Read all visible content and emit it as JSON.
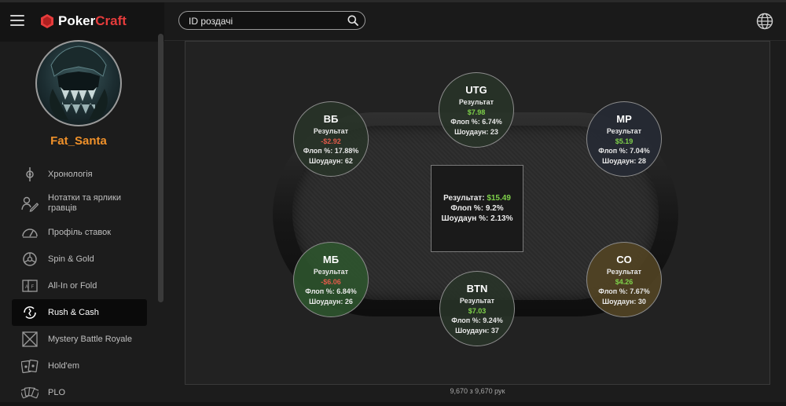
{
  "app": {
    "logo_part1": "Poker",
    "logo_part2": "Craft"
  },
  "user": {
    "name": "Fat_Santa"
  },
  "search": {
    "placeholder": "ID роздачі"
  },
  "nav": [
    {
      "label": "Хронологія",
      "icon": "timeline-icon"
    },
    {
      "label": "Нотатки та ярлики гравців",
      "icon": "notes-icon"
    },
    {
      "label": "Профіль ставок",
      "icon": "gauge-icon"
    },
    {
      "label": "Spin & Gold",
      "icon": "spin-icon"
    },
    {
      "label": "All-In or Fold",
      "icon": "allin-icon"
    },
    {
      "label": "Rush & Cash",
      "icon": "rush-icon",
      "active": true
    },
    {
      "label": "Mystery Battle Royale",
      "icon": "mystery-icon"
    },
    {
      "label": "Hold'em",
      "icon": "cards-icon"
    },
    {
      "label": "PLO",
      "icon": "plo-icon"
    }
  ],
  "summary": {
    "result_label": "Результат:",
    "result_value": "$15.49",
    "flop_label": "Флоп %:",
    "flop_value": "9.2%",
    "showdown_label": "Шоудаун %:",
    "showdown_value": "2.13%"
  },
  "seats": {
    "utg": {
      "pos": "UTG",
      "result_label": "Результат",
      "result": "$7.98",
      "flop": "Флоп %: 6.74%",
      "showdown": "Шоудаун: 23"
    },
    "bb": {
      "pos": "ВБ",
      "result_label": "Результат",
      "result": "-$2.92",
      "flop": "Флоп %: 17.88%",
      "showdown": "Шоудаун: 62"
    },
    "mp": {
      "pos": "MP",
      "result_label": "Результат",
      "result": "$5.19",
      "flop": "Флоп %: 7.04%",
      "showdown": "Шоудаун: 28"
    },
    "sb": {
      "pos": "МБ",
      "result_label": "Результат",
      "result": "-$6.06",
      "flop": "Флоп %: 6.84%",
      "showdown": "Шоудаун: 26"
    },
    "btn": {
      "pos": "BTN",
      "result_label": "Результат",
      "result": "$7.03",
      "flop": "Флоп %: 9.24%",
      "showdown": "Шоудаун: 37"
    },
    "co": {
      "pos": "CO",
      "result_label": "Результат",
      "result": "$4.26",
      "flop": "Флоп %: 7.67%",
      "showdown": "Шоудаун: 30"
    }
  },
  "footer": {
    "count_text": "9,670 з 9,670 рук"
  },
  "colors": {
    "accent_orange": "#f0912a",
    "positive": "#7fd24a",
    "negative": "#e25a4a",
    "logo_red": "#e63c3c"
  }
}
